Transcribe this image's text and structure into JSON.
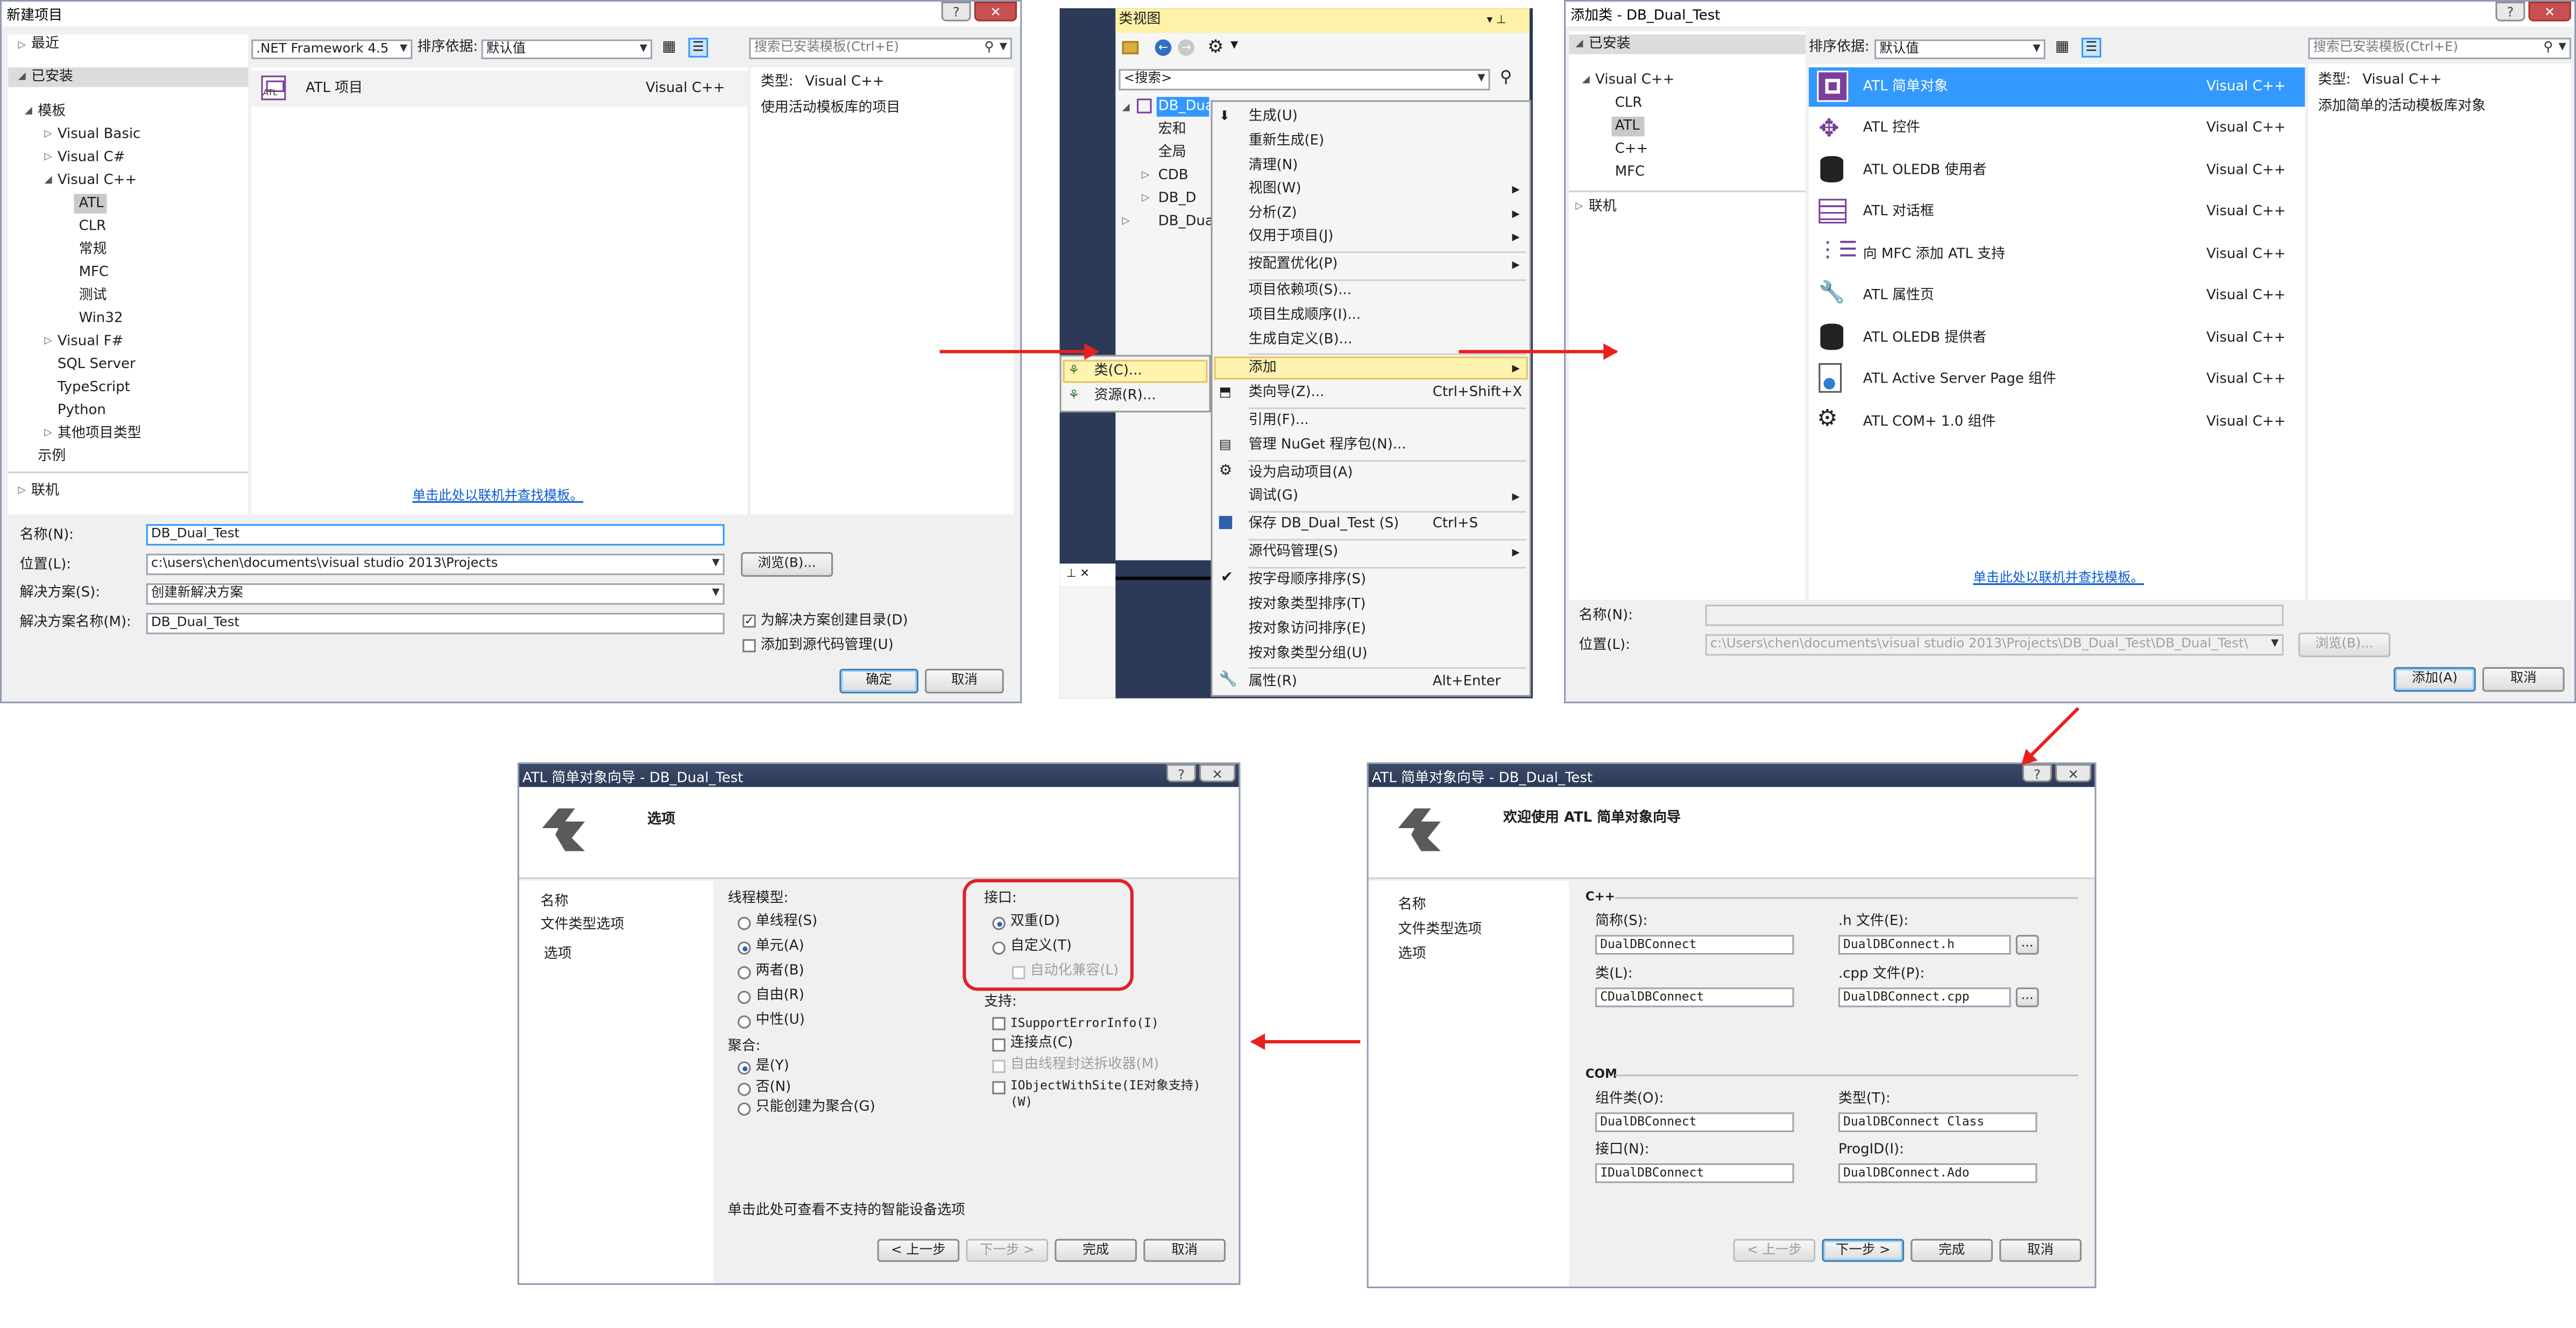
{
  "new_project": {
    "title": "新建项目",
    "tree": {
      "recent": "最近",
      "installed": "已安装",
      "templates": "模板",
      "vb": "Visual Basic",
      "cs": "Visual C#",
      "cpp": "Visual C++",
      "atl": "ATL",
      "clr": "CLR",
      "general": "常规",
      "mfc": "MFC",
      "test": "测试",
      "win32": "Win32",
      "fs": "Visual F#",
      "sql": "SQL Server",
      "ts": "TypeScript",
      "py": "Python",
      "other": "其他项目类型",
      "samples": "示例",
      "online": "联机"
    },
    "framework": ".NET Framework 4.5",
    "sort_label": "排序依据:",
    "sort_value": "默认值",
    "search_placeholder": "搜索已安装模板(Ctrl+E)",
    "item_name": "ATL 项目",
    "item_lang": "Visual C++",
    "type_label": "类型:",
    "type_value": "Visual C++",
    "description": "使用活动模板库的项目",
    "online_link": "单击此处以联机并查找模板。",
    "name_label": "名称(N):",
    "name_value": "DB_Dual_Test",
    "location_label": "位置(L):",
    "location_value": "c:\\users\\chen\\documents\\visual studio 2013\\Projects",
    "browse": "浏览(B)...",
    "solution_label": "解决方案(S):",
    "solution_value": "创建新解决方案",
    "solution_name_label": "解决方案名称(M):",
    "solution_name_value": "DB_Dual_Test",
    "create_dir": "为解决方案创建目录(D)",
    "add_source": "添加到源代码管理(U)",
    "ok": "确定",
    "cancel": "取消"
  },
  "class_view": {
    "title": "类视图",
    "search": "<搜索>",
    "root": "DB_Dual",
    "nodes": [
      "宏和",
      "全局",
      "CDB",
      "DB_D",
      "DB_Dua"
    ],
    "submenu": [
      "类(C)...",
      "资源(R)..."
    ],
    "menu": [
      {
        "label": "生成(U)",
        "shortcut": ""
      },
      {
        "label": "重新生成(E)",
        "shortcut": ""
      },
      {
        "label": "清理(N)",
        "shortcut": ""
      },
      {
        "label": "视图(W)",
        "shortcut": ""
      },
      {
        "label": "分析(Z)",
        "shortcut": ""
      },
      {
        "label": "仅用于项目(J)",
        "shortcut": ""
      },
      {
        "label": "按配置优化(P)",
        "shortcut": ""
      },
      {
        "label": "项目依赖项(S)...",
        "shortcut": ""
      },
      {
        "label": "项目生成顺序(I)...",
        "shortcut": ""
      },
      {
        "label": "生成自定义(B)...",
        "shortcut": ""
      },
      {
        "label": "添加",
        "shortcut": ""
      },
      {
        "label": "类向导(Z)...",
        "shortcut": "Ctrl+Shift+X"
      },
      {
        "label": "引用(F)...",
        "shortcut": ""
      },
      {
        "label": "管理 NuGet 程序包(N)...",
        "shortcut": ""
      },
      {
        "label": "设为启动项目(A)",
        "shortcut": ""
      },
      {
        "label": "调试(G)",
        "shortcut": ""
      },
      {
        "label": "保存 DB_Dual_Test (S)",
        "shortcut": "Ctrl+S"
      },
      {
        "label": "源代码管理(S)",
        "shortcut": ""
      },
      {
        "label": "按字母顺序排序(S)",
        "shortcut": ""
      },
      {
        "label": "按对象类型排序(T)",
        "shortcut": ""
      },
      {
        "label": "按对象访问排序(E)",
        "shortcut": ""
      },
      {
        "label": "按对象类型分组(U)",
        "shortcut": ""
      },
      {
        "label": "属性(R)",
        "shortcut": "Alt+Enter"
      }
    ]
  },
  "add_class": {
    "title": "添加类 - DB_Dual_Test",
    "installed": "已安装",
    "tree": [
      "Visual C++",
      "CLR",
      "ATL",
      "C++",
      "MFC"
    ],
    "online": "联机",
    "sort_label": "排序依据:",
    "sort_value": "默认值",
    "search_placeholder": "搜索已安装模板(Ctrl+E)",
    "items": [
      {
        "name": "ATL 简单对象",
        "lang": "Visual C++"
      },
      {
        "name": "ATL 控件",
        "lang": "Visual C++"
      },
      {
        "name": "ATL OLEDB 使用者",
        "lang": "Visual C++"
      },
      {
        "name": "ATL 对话框",
        "lang": "Visual C++"
      },
      {
        "name": "向 MFC 添加 ATL 支持",
        "lang": "Visual C++"
      },
      {
        "name": "ATL 属性页",
        "lang": "Visual C++"
      },
      {
        "name": "ATL OLEDB 提供者",
        "lang": "Visual C++"
      },
      {
        "name": "ATL Active Server Page 组件",
        "lang": "Visual C++"
      },
      {
        "name": "ATL COM+ 1.0 组件",
        "lang": "Visual C++"
      }
    ],
    "type_label": "类型:",
    "type_value": "Visual C++",
    "description": "添加简单的活动模板库对象",
    "online_link": "单击此处以联机并查找模板。",
    "name_label": "名称(N):",
    "location_label": "位置(L):",
    "location_value": "c:\\Users\\chen\\documents\\visual studio 2013\\Projects\\DB_Dual_Test\\DB_Dual_Test\\",
    "browse": "浏览(B)...",
    "add": "添加(A)",
    "cancel": "取消"
  },
  "wizard_welcome": {
    "title": "ATL 简单对象向导 - DB_Dual_Test",
    "heading": "欢迎使用 ATL 简单对象向导",
    "nav": [
      "名称",
      "文件类型选项",
      "选项"
    ],
    "cpp_section": "C++",
    "short_name_label": "简称(S):",
    "short_name": "DualDBConnect",
    "h_file_label": ".h 文件(E):",
    "h_file": "DualDBConnect.h",
    "class_label": "类(L):",
    "class_value": "CDualDBConnect",
    "cpp_file_label": ".cpp 文件(P):",
    "cpp_file": "DualDBConnect.cpp",
    "com_section": "COM",
    "coclass_label": "组件类(O):",
    "coclass": "DualDBConnect",
    "type_label": "类型(T):",
    "type_value": "DualDBConnect Class",
    "interface_label": "接口(N):",
    "interface_value": "IDualDBConnect",
    "progid_label": "ProgID(I):",
    "progid": "DualDBConnect.Ado",
    "dots": "...",
    "prev": "< 上一步",
    "next": "下一步 >",
    "finish": "完成",
    "cancel": "取消"
  },
  "wizard_options": {
    "title": "ATL 简单对象向导 - DB_Dual_Test",
    "heading": "选项",
    "nav": [
      "名称",
      "文件类型选项",
      "选项"
    ],
    "threading_label": "线程模型:",
    "threading": [
      "单线程(S)",
      "单元(A)",
      "两者(B)",
      "自由(R)",
      "中性(U)"
    ],
    "aggregation_label": "聚合:",
    "aggregation": [
      "是(Y)",
      "否(N)",
      "只能创建为聚合(G)"
    ],
    "interface_label": "接口:",
    "interface": [
      "双重(D)",
      "自定义(T)"
    ],
    "automation": "自动化兼容(L)",
    "support_label": "支持:",
    "support": [
      "ISupportErrorInfo(I)",
      "连接点(C)",
      "自由线程封送拆收器(M)",
      "IObjectWithSite(IE对象支持)(W)"
    ],
    "smart_device_note": "单击此处可查看不支持的智能设备选项",
    "prev": "< 上一步",
    "next": "下一步 >",
    "finish": "完成",
    "cancel": "取消"
  },
  "colors": {
    "accent_blue": "#3399ff",
    "arrow_red": "#e8201c",
    "link_blue": "#0b5bd1"
  }
}
